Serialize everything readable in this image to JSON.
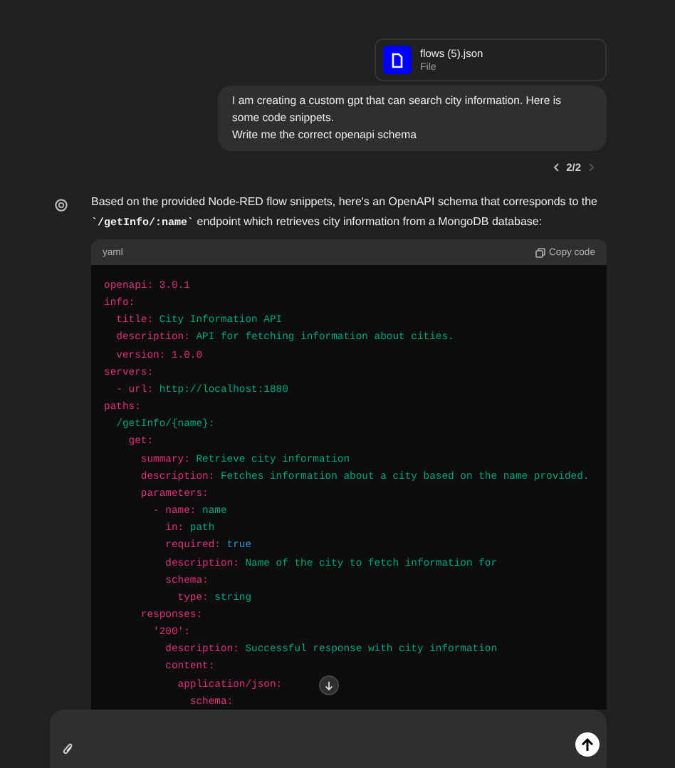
{
  "attachment": {
    "name": "flows (5).json",
    "type": "File"
  },
  "user_message": {
    "lines": [
      "I am creating a custom gpt that can search city information. Here is",
      "some code snippets.",
      "Write me  the correct openapi schema"
    ]
  },
  "pager": {
    "text": "2/2"
  },
  "assistant_message": {
    "text": "Based on the provided Node-RED flow snippets, here's an OpenAPI schema that corresponds to the **`/getInfo/:name`** endpoint which retrieves city information from a MongoDB database:",
    "code": {
      "language": "yaml",
      "copy_label": "Copy code",
      "lines": [
        [
          {
            "text": "openapi:",
            "kind": "attr"
          },
          {
            "text": " 3.0.1",
            "kind": "number"
          }
        ],
        [
          {
            "text": "info:",
            "kind": "attr"
          }
        ],
        [
          {
            "text": "  title:",
            "kind": "attr"
          },
          {
            "text": " City Information API",
            "kind": "string"
          }
        ],
        [
          {
            "text": "  description:",
            "kind": "attr"
          },
          {
            "text": " API for fetching information about cities.",
            "kind": "string"
          }
        ],
        [
          {
            "text": "  version:",
            "kind": "attr"
          },
          {
            "text": " 1.0.0",
            "kind": "number"
          }
        ],
        [
          {
            "text": "servers:",
            "kind": "attr"
          }
        ],
        [
          {
            "text": "  - url:",
            "kind": "attr"
          },
          {
            "text": " http://localhost:1880",
            "kind": "string"
          }
        ],
        [
          {
            "text": "paths:",
            "kind": "attr"
          }
        ],
        [
          {
            "text": "  /getInfo/{name}:",
            "kind": "string"
          }
        ],
        [
          {
            "text": "    get:",
            "kind": "attr"
          }
        ],
        [
          {
            "text": "      summary:",
            "kind": "attr"
          },
          {
            "text": " Retrieve city information",
            "kind": "string"
          }
        ],
        [
          {
            "text": "      description:",
            "kind": "attr"
          },
          {
            "text": " Fetches information about a city based on the name provided.",
            "kind": "string"
          }
        ],
        [
          {
            "text": "      parameters:",
            "kind": "attr"
          }
        ],
        [
          {
            "text": "        - name:",
            "kind": "attr"
          },
          {
            "text": " name",
            "kind": "string"
          }
        ],
        [
          {
            "text": "          in:",
            "kind": "attr"
          },
          {
            "text": " path",
            "kind": "string"
          }
        ],
        [
          {
            "text": "          required:",
            "kind": "attr"
          },
          {
            "text": " true",
            "kind": "literal"
          }
        ],
        [
          {
            "text": "          description:",
            "kind": "attr"
          },
          {
            "text": " Name of the city to fetch information for",
            "kind": "string"
          }
        ],
        [
          {
            "text": "          schema:",
            "kind": "attr"
          }
        ],
        [
          {
            "text": "            type:",
            "kind": "attr"
          },
          {
            "text": " string",
            "kind": "string"
          }
        ],
        [
          {
            "text": "      responses:",
            "kind": "attr"
          }
        ],
        [
          {
            "text": "        '200':",
            "kind": "attr"
          }
        ],
        [
          {
            "text": "          description:",
            "kind": "attr"
          },
          {
            "text": " Successful response with city information",
            "kind": "string"
          }
        ],
        [
          {
            "text": "          content:",
            "kind": "attr"
          }
        ],
        [
          {
            "text": "            application/json:",
            "kind": "attr"
          }
        ],
        [
          {
            "text": "              schema:",
            "kind": "attr"
          }
        ]
      ]
    }
  }
}
